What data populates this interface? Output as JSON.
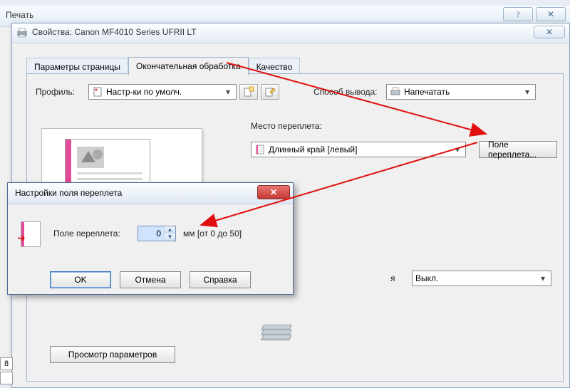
{
  "bgWindow": {
    "title": "Печать"
  },
  "propsWindow": {
    "title": "Свойства: Canon MF4010 Series UFRII LT",
    "close_glyph": "✕"
  },
  "tabs": {
    "page_params": "Параметры страницы",
    "finishing": "Окончательная обработка",
    "quality": "Качество"
  },
  "profile": {
    "label": "Профиль:",
    "value": "Настр-ки по умолч."
  },
  "output": {
    "label": "Способ вывода:",
    "value": "Напечатать"
  },
  "binding": {
    "label": "Место переплета:",
    "value": "Длинный край [левый]",
    "button_label": "Поле переплета..."
  },
  "finishing_combo": {
    "value": "Выкл."
  },
  "view_params_btn": "Просмотр параметров",
  "gutterDialog": {
    "title": "Настройки поля переплета",
    "field_label": "Поле переплета:",
    "value": "0",
    "unit_hint": "мм [от 0 до 50]",
    "ok": "OK",
    "cancel": "Отмена",
    "help": "Справка",
    "close_glyph": "✕"
  },
  "bg_help_glyph": "?",
  "bg_close_glyph": "✕",
  "leftEdge": {
    "cell": "8"
  }
}
